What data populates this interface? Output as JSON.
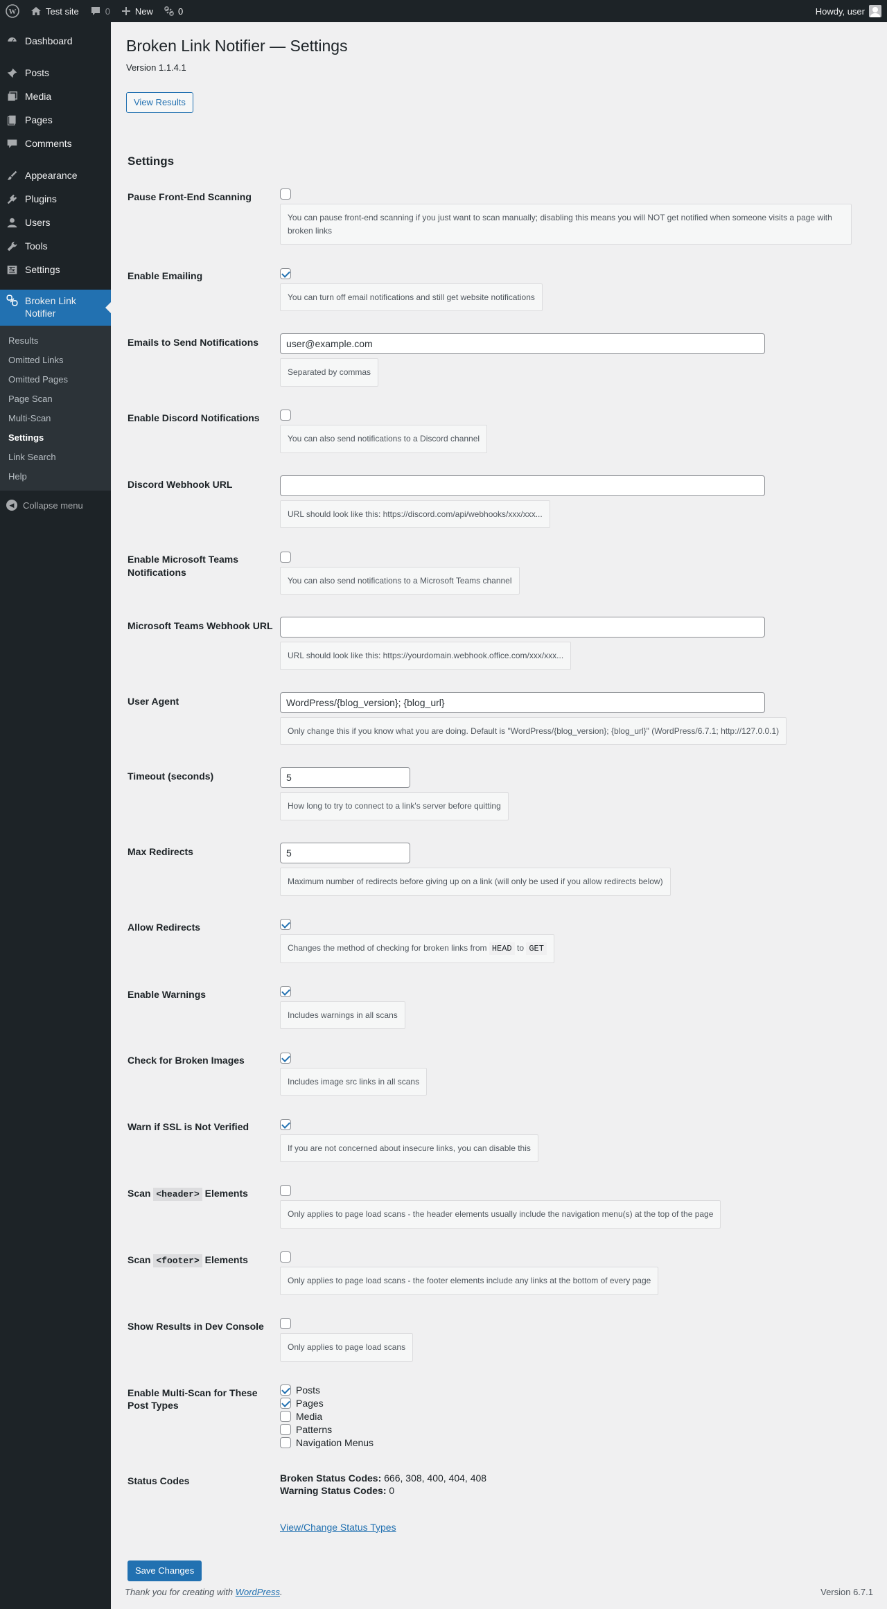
{
  "adminbar": {
    "site_name": "Test site",
    "comments_count": "0",
    "new_label": "New",
    "updates_count": "0",
    "howdy": "Howdy, user"
  },
  "sidebar": {
    "items": [
      {
        "label": "Dashboard",
        "icon": "dashboard-icon"
      },
      {
        "label": "Posts",
        "icon": "pin-icon"
      },
      {
        "label": "Media",
        "icon": "media-icon"
      },
      {
        "label": "Pages",
        "icon": "pages-icon"
      },
      {
        "label": "Comments",
        "icon": "comment-icon"
      },
      {
        "label": "Appearance",
        "icon": "brush-icon"
      },
      {
        "label": "Plugins",
        "icon": "plug-icon"
      },
      {
        "label": "Users",
        "icon": "user-icon"
      },
      {
        "label": "Tools",
        "icon": "wrench-icon"
      },
      {
        "label": "Settings",
        "icon": "sliders-icon"
      }
    ],
    "current": {
      "label": "Broken Link Notifier",
      "icon": "broken-link-icon"
    },
    "submenu": [
      "Results",
      "Omitted Links",
      "Omitted Pages",
      "Page Scan",
      "Multi-Scan",
      "Settings",
      "Link Search",
      "Help"
    ],
    "collapse_label": "Collapse menu"
  },
  "page": {
    "title": "Broken Link Notifier — Settings",
    "version": "Version 1.1.4.1",
    "view_results_label": "View Results",
    "section_title": "Settings"
  },
  "fields": {
    "pause": {
      "label": "Pause Front-End Scanning",
      "checked": false,
      "desc": "You can pause front-end scanning if you just want to scan manually; disabling this means you will NOT get notified when someone visits a page with broken links"
    },
    "emailing": {
      "label": "Enable Emailing",
      "checked": true,
      "desc": "You can turn off email notifications and still get website notifications"
    },
    "emails": {
      "label": "Emails to Send Notifications",
      "value": "user@example.com",
      "desc": "Separated by commas"
    },
    "discord": {
      "label": "Enable Discord Notifications",
      "checked": false,
      "desc": "You can also send notifications to a Discord channel"
    },
    "discord_url": {
      "label": "Discord Webhook URL",
      "value": "",
      "desc": "URL should look like this: https://discord.com/api/webhooks/xxx/xxx..."
    },
    "teams": {
      "label": "Enable Microsoft Teams Notifications",
      "checked": false,
      "desc": "You can also send notifications to a Microsoft Teams channel"
    },
    "teams_url": {
      "label": "Microsoft Teams Webhook URL",
      "value": "",
      "desc": "URL should look like this: https://yourdomain.webhook.office.com/xxx/xxx..."
    },
    "user_agent": {
      "label": "User Agent",
      "value": "WordPress/{blog_version}; {blog_url}",
      "desc": "Only change this if you know what you are doing. Default is \"WordPress/{blog_version}; {blog_url}\" (WordPress/6.7.1; http://127.0.0.1)"
    },
    "timeout": {
      "label": "Timeout (seconds)",
      "value": "5",
      "desc": "How long to try to connect to a link's server before quitting"
    },
    "max_redirects": {
      "label": "Max Redirects",
      "value": "5",
      "desc": "Maximum number of redirects before giving up on a link (will only be used if you allow redirects below)"
    },
    "allow_redirects": {
      "label": "Allow Redirects",
      "checked": true,
      "desc_pre": "Changes the method of checking for broken links from",
      "code1": "HEAD",
      "desc_mid": "to",
      "code2": "GET"
    },
    "warnings": {
      "label": "Enable Warnings",
      "checked": true,
      "desc": "Includes warnings in all scans"
    },
    "images": {
      "label": "Check for Broken Images",
      "checked": true,
      "desc": "Includes image src links in all scans"
    },
    "ssl": {
      "label": "Warn if SSL is Not Verified",
      "checked": true,
      "desc": "If you are not concerned about insecure links, you can disable this"
    },
    "header": {
      "label_pre": "Scan",
      "code": "<header>",
      "label_post": "Elements",
      "checked": false,
      "desc": "Only applies to page load scans - the header elements usually include the navigation menu(s) at the top of the page"
    },
    "footer": {
      "label_pre": "Scan",
      "code": "<footer>",
      "label_post": "Elements",
      "checked": false,
      "desc": "Only applies to page load scans - the footer elements include any links at the bottom of every page"
    },
    "dev_console": {
      "label": "Show Results in Dev Console",
      "checked": false,
      "desc": "Only applies to page load scans"
    },
    "multiscan": {
      "label": "Enable Multi-Scan for These Post Types",
      "types": [
        {
          "name": "Posts",
          "checked": true
        },
        {
          "name": "Pages",
          "checked": true
        },
        {
          "name": "Media",
          "checked": false
        },
        {
          "name": "Patterns",
          "checked": false
        },
        {
          "name": "Navigation Menus",
          "checked": false
        }
      ]
    },
    "status": {
      "label": "Status Codes",
      "broken_label": "Broken Status Codes:",
      "broken_value": "666, 308, 400, 404, 408",
      "warning_label": "Warning Status Codes:",
      "warning_value": "0",
      "link": "View/Change Status Types"
    }
  },
  "save_label": "Save Changes",
  "footer": {
    "thanks_pre": "Thank you for creating with",
    "wp_link": "WordPress",
    "thanks_post": ".",
    "version": "Version 6.7.1"
  }
}
